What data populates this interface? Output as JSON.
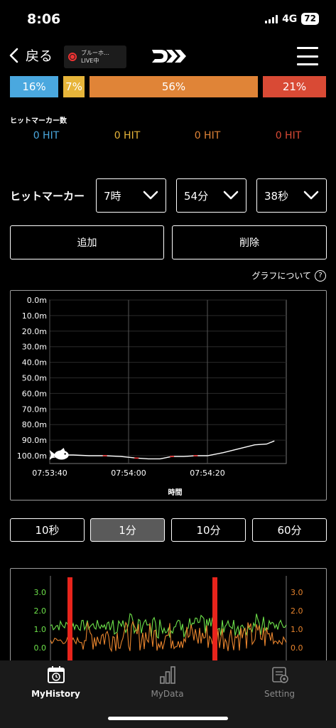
{
  "status_bar": {
    "time": "8:06",
    "network": "4G",
    "battery": "72"
  },
  "nav": {
    "back_label": "戻る",
    "live_title": "ブルーホ…",
    "live_status": "LIVE中",
    "logo": "DAIWA"
  },
  "distribution": [
    {
      "label": "16%",
      "value": 16,
      "color": "#4aa8df"
    },
    {
      "label": "7%",
      "value": 7,
      "color": "#e7b53a"
    },
    {
      "label": "56%",
      "value": 56,
      "color": "#e08437"
    },
    {
      "label": "21%",
      "value": 21,
      "color": "#d94a35"
    }
  ],
  "hit_counts": {
    "title": "ヒットマーカー数",
    "items": [
      {
        "label": "0 HIT",
        "color": "#4aa8df"
      },
      {
        "label": "0 HIT",
        "color": "#e7b53a"
      },
      {
        "label": "0 HIT",
        "color": "#e08437"
      },
      {
        "label": "0 HIT",
        "color": "#d94a35"
      }
    ]
  },
  "hit_marker": {
    "label": "ヒットマーカー",
    "hour": "7時",
    "minute": "54分",
    "second": "38秒",
    "add_label": "追加",
    "delete_label": "削除"
  },
  "graph_help": "グラフについて",
  "ranges": [
    "10秒",
    "1分",
    "10分",
    "60分"
  ],
  "active_range": "1分",
  "chart_data": [
    {
      "type": "line",
      "title": "",
      "xlabel": "時間",
      "ylabel": "",
      "x_ticks": [
        "07:53:40",
        "07:54:00",
        "07:54:20"
      ],
      "y_ticks": [
        "0.0m",
        "10.0m",
        "20.0m",
        "30.0m",
        "40.0m",
        "50.0m",
        "60.0m",
        "70.0m",
        "80.0m",
        "90.0m",
        "100.0m"
      ],
      "ylim": [
        0,
        105
      ],
      "y_inverted": true,
      "grid": true,
      "series": [
        {
          "x": [
            "07:53:40",
            "07:53:44",
            "07:53:46",
            "07:53:50",
            "07:53:54",
            "07:53:58",
            "07:54:00",
            "07:54:02",
            "07:54:05",
            "07:54:08",
            "07:54:11",
            "07:54:14",
            "07:54:17",
            "07:54:20",
            "07:54:24",
            "07:54:28",
            "07:54:32",
            "07:54:35",
            "07:54:37"
          ],
          "values": [
            101.5,
            99.5,
            99.5,
            100.0,
            100.0,
            100.5,
            101.0,
            101.5,
            102.0,
            102.0,
            100.5,
            100.5,
            100.0,
            100.0,
            98.0,
            95.5,
            93.0,
            92.5,
            90.5
          ],
          "color": "#ffffff"
        }
      ],
      "marker": {
        "icon": "fish-icon",
        "x": "07:53:43",
        "y": 99.5
      }
    },
    {
      "type": "line",
      "title": "",
      "y_ticks_left": [
        "3.0",
        "2.0",
        "1.0",
        "0.0"
      ],
      "y_ticks_right": [
        "3.0",
        "2.0",
        "1.0",
        "0.0"
      ],
      "series": [
        {
          "color": "#6de14a",
          "mean": 1.2
        },
        {
          "color": "#e8842d",
          "mean": 0.3
        }
      ],
      "markers_color": "#e8241c"
    }
  ],
  "tabs": [
    {
      "label": "MyHistory",
      "icon": "history-calendar-icon",
      "active": true
    },
    {
      "label": "MyData",
      "icon": "bar-chart-icon",
      "active": false
    },
    {
      "label": "Setting",
      "icon": "settings-icon",
      "active": false
    }
  ]
}
